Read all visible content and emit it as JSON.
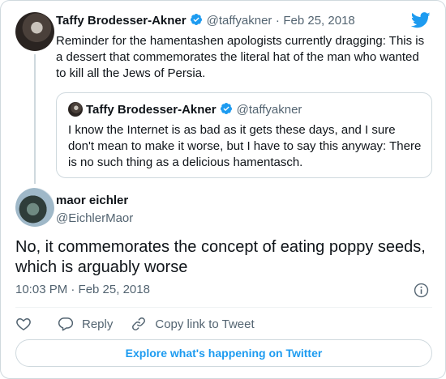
{
  "colors": {
    "accent": "#1d9bf0",
    "muted": "#536471",
    "text": "#0f1419",
    "border": "#cfd9de"
  },
  "parent_tweet": {
    "author_name": "Taffy Brodesser-Akner",
    "handle": "@taffyakner",
    "separator": "·",
    "date": "Feb 25, 2018",
    "text": "Reminder for the hamentashen apologists currently dragging: This is a dessert that commemorates the literal hat of the man who wanted to kill all the Jews of Persia.",
    "verified": true
  },
  "quoted_tweet": {
    "author_name": "Taffy Brodesser-Akner",
    "handle": "@taffyakner",
    "text": "I know the Internet is as bad as it gets these days, and I sure don't mean to make it worse, but I have to say this anyway: There is no such thing as a delicious hamentasch.",
    "verified": true
  },
  "main_tweet": {
    "author_name": "maor eichler",
    "handle": "@EichlerMaor",
    "text": "No, it commemorates the concept of eating poppy seeds, which is arguably worse",
    "timestamp": "10:03 PM · Feb 25, 2018"
  },
  "actions": {
    "reply_label": "Reply",
    "copy_link_label": "Copy link to Tweet"
  },
  "explore_label": "Explore what's happening on Twitter",
  "icons": [
    "twitter-bird-icon",
    "verified-badge-icon",
    "info-icon",
    "heart-icon",
    "reply-icon",
    "link-icon"
  ]
}
